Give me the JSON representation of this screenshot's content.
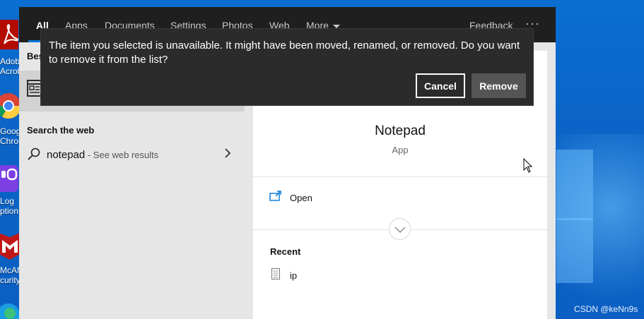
{
  "desktop": {
    "icons": [
      {
        "icon": "acrobat-icon",
        "line1": "Adob",
        "line2": "Acroba"
      },
      {
        "icon": "chrome-icon",
        "line1": "Goog",
        "line2": "Chron"
      },
      {
        "icon": "logi-options-icon",
        "line1": "Log",
        "line2": "ption"
      },
      {
        "icon": "mcafee-icon",
        "line1": "McAf",
        "line2": "curity"
      }
    ],
    "watermark": "CSDN @keNn9s"
  },
  "search": {
    "tabs": [
      {
        "label": "All",
        "active": true
      },
      {
        "label": "Apps"
      },
      {
        "label": "Documents"
      },
      {
        "label": "Settings"
      },
      {
        "label": "Photos"
      },
      {
        "label": "Web"
      },
      {
        "label": "More"
      }
    ],
    "feedback": "Feedback",
    "more_options": "···",
    "best_match_label": "Bes",
    "web_heading": "Search the web",
    "web_query": "notepad",
    "web_sub": " - See web results",
    "detail": {
      "app_name": "Notepad",
      "app_type": "App",
      "open_label": "Open",
      "recent_label": "Recent",
      "recent_items": [
        "ip"
      ]
    }
  },
  "dialog": {
    "message": "The item you selected is unavailable. It might have been moved, renamed, or removed. Do you want to remove it from the list?",
    "cancel_label": "Cancel",
    "remove_label": "Remove"
  },
  "colors": {
    "accent": "#0078d7",
    "topbar": "#1f1f1f",
    "dialog_bg": "#2b2b2b",
    "remove_button": "#555555"
  }
}
